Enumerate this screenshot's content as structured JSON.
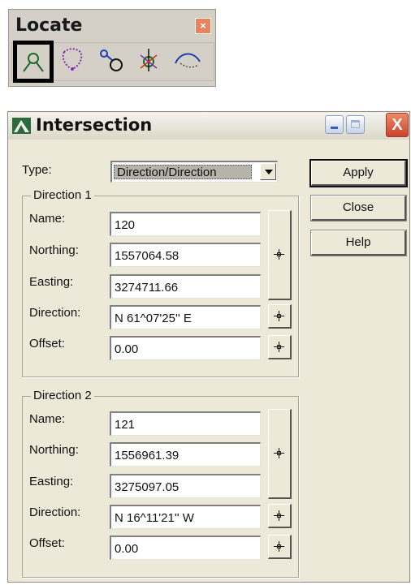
{
  "locate_toolbar": {
    "title": "Locate",
    "close_symbol": "×",
    "tools": [
      {
        "icon": "locate-intersection-icon",
        "selected": true
      },
      {
        "icon": "locate-curve-icon"
      },
      {
        "icon": "locate-circle-tangent-icon"
      },
      {
        "icon": "locate-point-projection-icon"
      },
      {
        "icon": "locate-arc-icon"
      }
    ]
  },
  "dialog": {
    "title": "Intersection",
    "title_icon": "intersection-app-icon",
    "close_symbol": "X",
    "type_label": "Type:",
    "type_value": "Direction/Direction",
    "buttons": {
      "apply": "Apply",
      "close": "Close",
      "help": "Help"
    },
    "group1": {
      "title": "Direction 1",
      "name_label": "Name:",
      "name_value": "120",
      "northing_label": "Northing:",
      "northing_value": "1557064.58",
      "easting_label": "Easting:",
      "easting_value": "3274711.66",
      "direction_label": "Direction:",
      "direction_value": "N 61^07'25'' E",
      "offset_label": "Offset:",
      "offset_value": "0.00"
    },
    "group2": {
      "title": "Direction 2",
      "name_label": "Name:",
      "name_value": "121",
      "northing_label": "Northing:",
      "northing_value": "1556961.39",
      "easting_label": "Easting:",
      "easting_value": "3275097.05",
      "direction_label": "Direction:",
      "direction_value": "N 16^11'21'' W",
      "offset_label": "Offset:",
      "offset_value": "0.00"
    }
  }
}
